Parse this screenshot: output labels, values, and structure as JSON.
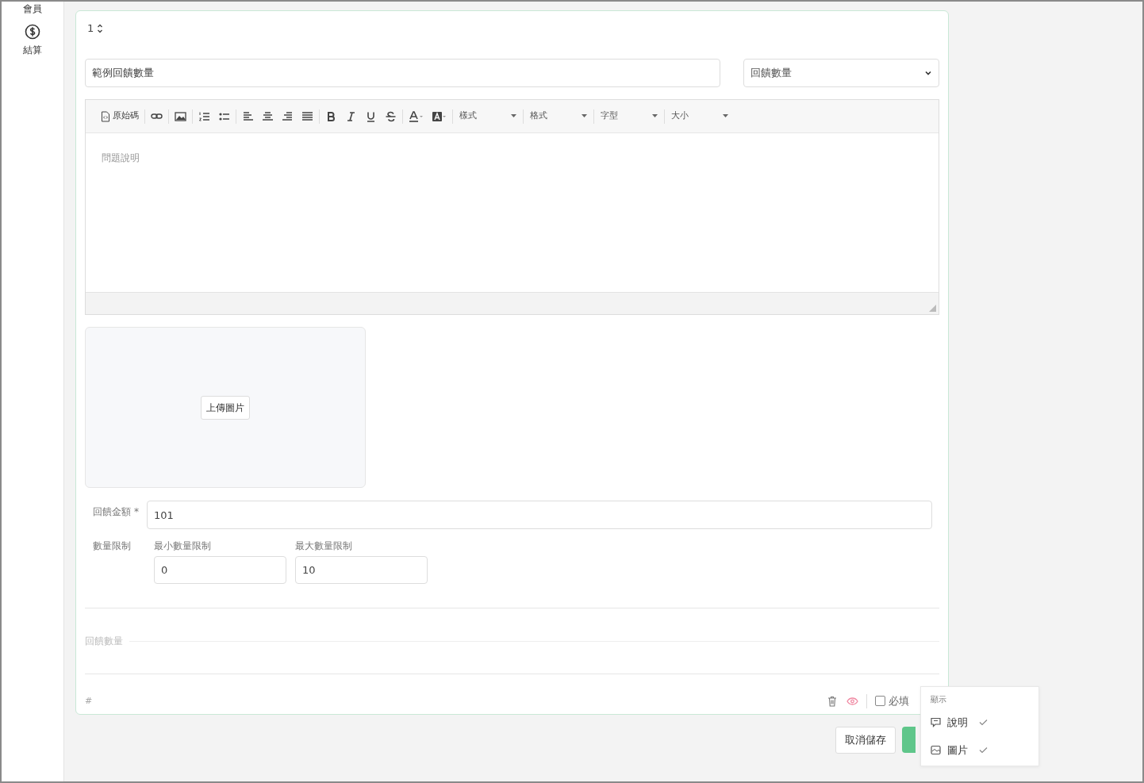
{
  "sidebar": {
    "items": [
      {
        "label": "會員",
        "kind": "label-only"
      },
      {
        "label": "結算",
        "kind": "with-icon"
      }
    ]
  },
  "question": {
    "order": "1",
    "title_value": "範例回饋數量",
    "type_value": "回饋數量",
    "toolbar": {
      "source_label": "原始碼",
      "dropdowns": [
        "樣式",
        "格式",
        "字型",
        "大小"
      ]
    },
    "description_placeholder": "問題說明",
    "upload_button": "上傳圖片",
    "amount": {
      "label": "回饋金額",
      "required_mark": "*",
      "value": "101"
    },
    "limit": {
      "label": "數量限制",
      "min_label": "最小數量限制",
      "min_value": "0",
      "max_label": "最大數量限制",
      "max_value": "10"
    },
    "section_label": "回饋數量",
    "hash": "#",
    "footer": {
      "required": {
        "label": "必填",
        "checked": false
      }
    }
  },
  "actions": {
    "cancel": "取消儲存"
  },
  "display_menu": {
    "title": "顯示",
    "items": [
      {
        "label": "說明",
        "kind": "comment",
        "checked": true
      },
      {
        "label": "圖片",
        "kind": "image",
        "checked": true
      }
    ]
  }
}
